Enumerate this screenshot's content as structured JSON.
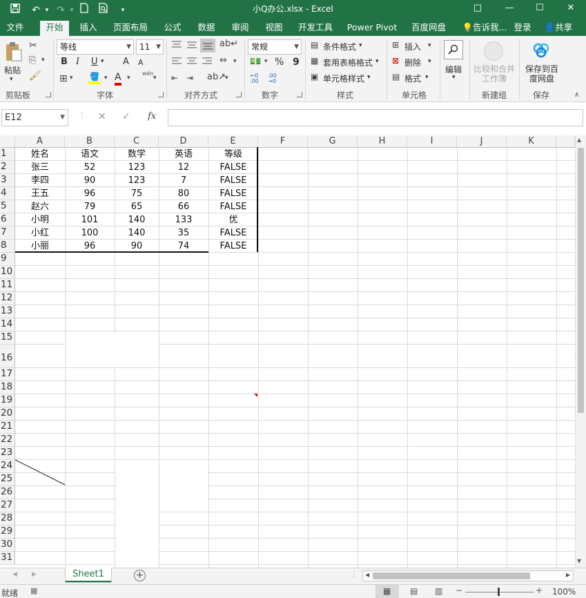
{
  "window": {
    "title": "小Q办公.xlsx - Excel",
    "controls": {
      "ribbon_options": "□",
      "minimize": "—",
      "maximize": "☐",
      "close": "✕"
    }
  },
  "quick_access": {
    "save_icon": "save-icon",
    "undo_icon": "undo-icon",
    "redo_icon": "redo-icon",
    "new_icon": "new-file-icon",
    "preview_icon": "print-preview-icon",
    "customize_icon": "customize-icon"
  },
  "tabs": [
    "文件",
    "开始",
    "插入",
    "页面布局",
    "公式",
    "数据",
    "审阅",
    "视图",
    "开发工具",
    "Power Pivot",
    "百度网盘"
  ],
  "active_tab": "开始",
  "tell_me": "告诉我...",
  "login": "登录",
  "share": "共享",
  "ribbon": {
    "clipboard": {
      "label": "剪贴板",
      "paste": "粘贴"
    },
    "font": {
      "label": "字体",
      "font_name": "等线",
      "font_size": "11",
      "bold": "B",
      "italic": "I",
      "underline": "U",
      "grow": "A",
      "shrink": "A",
      "phonetic": "wén",
      "font_color_letter": "A"
    },
    "alignment": {
      "label": "对齐方式"
    },
    "number": {
      "label": "数字",
      "format": "常规",
      "percent": "%",
      "comma": "9"
    },
    "styles": {
      "label": "样式",
      "conditional": "条件格式",
      "table": "套用表格格式",
      "cell_styles": "单元格样式"
    },
    "cells": {
      "label": "单元格",
      "insert": "插入",
      "delete": "删除",
      "format": "格式"
    },
    "editing": {
      "label": "编辑"
    },
    "new_group": {
      "label": "新建组",
      "compare": "比较和合并工作簿"
    },
    "save": {
      "label": "保存",
      "baidu": "保存到百度网盘"
    }
  },
  "formula_bar": {
    "name_box": "E12",
    "fx": "fx",
    "cancel": "✕",
    "enter": "✓",
    "value": ""
  },
  "columns": [
    "A",
    "B",
    "C",
    "D",
    "E",
    "F",
    "G",
    "H",
    "I",
    "J",
    "K"
  ],
  "rows": [
    "1",
    "2",
    "3",
    "4",
    "5",
    "6",
    "7",
    "8",
    "9",
    "10",
    "11",
    "12",
    "13",
    "14",
    "15",
    "16",
    "17",
    "18",
    "19",
    "20",
    "21",
    "22",
    "23",
    "24",
    "25",
    "26",
    "27",
    "28",
    "29",
    "30",
    "31"
  ],
  "table": {
    "header": [
      "姓名",
      "语文",
      "数学",
      "英语",
      "等级"
    ],
    "rows": [
      [
        "张三",
        "52",
        "123",
        "12",
        "FALSE"
      ],
      [
        "李四",
        "90",
        "123",
        "7",
        "FALSE"
      ],
      [
        "王五",
        "96",
        "75",
        "80",
        "FALSE"
      ],
      [
        "赵六",
        "79",
        "65",
        "66",
        "FALSE"
      ],
      [
        "小明",
        "101",
        "140",
        "133",
        "优"
      ],
      [
        "小红",
        "100",
        "140",
        "35",
        "FALSE"
      ],
      [
        "小丽",
        "96",
        "90",
        "74",
        "FALSE"
      ]
    ]
  },
  "sheet_tab": "Sheet1",
  "status": {
    "ready": "就绪",
    "zoom": "100%"
  },
  "colors": {
    "excel_green": "#217346",
    "ribbon_bg": "#f3f3f3"
  }
}
